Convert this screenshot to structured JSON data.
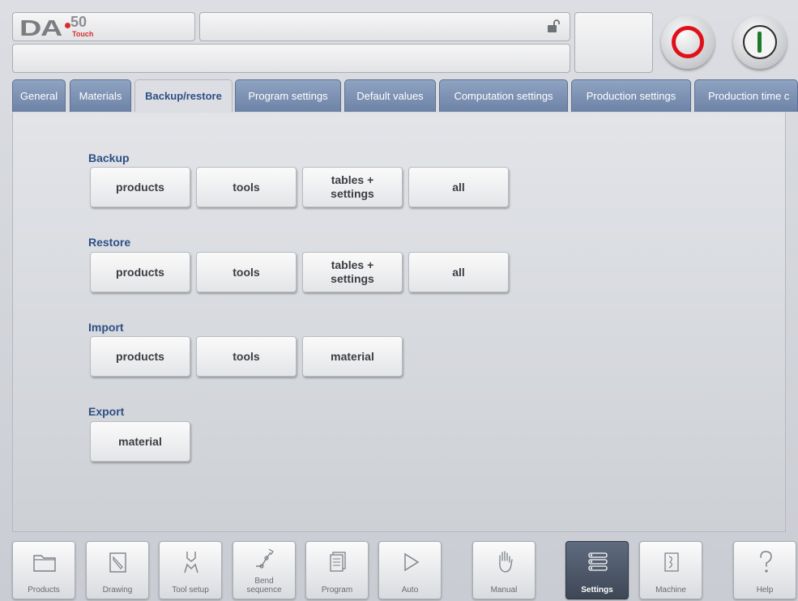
{
  "header": {
    "logo_main": "DA",
    "logo_model": "50",
    "logo_sub": "Touch"
  },
  "tabs": [
    {
      "label": "General",
      "active": false
    },
    {
      "label": "Materials",
      "active": false
    },
    {
      "label": "Backup/restore",
      "active": true
    },
    {
      "label": "Program settings",
      "active": false
    },
    {
      "label": "Default values",
      "active": false
    },
    {
      "label": "Computation settings",
      "active": false
    },
    {
      "label": "Production settings",
      "active": false
    },
    {
      "label": "Production time c",
      "active": false
    }
  ],
  "sections": {
    "backup": {
      "label": "Backup",
      "buttons": [
        "products",
        "tools",
        "tables +\nsettings",
        "all"
      ]
    },
    "restore": {
      "label": "Restore",
      "buttons": [
        "products",
        "tools",
        "tables +\nsettings",
        "all"
      ]
    },
    "import": {
      "label": "Import",
      "buttons": [
        "products",
        "tools",
        "material"
      ]
    },
    "export": {
      "label": "Export",
      "buttons": [
        "material"
      ]
    }
  },
  "nav": [
    {
      "label": "Products",
      "icon": "folder-icon",
      "active": false
    },
    {
      "label": "Drawing",
      "icon": "drawing-icon",
      "active": false
    },
    {
      "label": "Tool setup",
      "icon": "tool-setup-icon",
      "active": false
    },
    {
      "label": "Bend\nsequence",
      "icon": "bend-sequence-icon",
      "active": false
    },
    {
      "label": "Program",
      "icon": "program-icon",
      "active": false
    },
    {
      "label": "Auto",
      "icon": "play-icon",
      "active": false
    },
    {
      "label": "Manual",
      "icon": "hand-icon",
      "active": false
    },
    {
      "label": "Settings",
      "icon": "settings-list-icon",
      "active": true
    },
    {
      "label": "Machine",
      "icon": "machine-icon",
      "active": false
    },
    {
      "label": "Help",
      "icon": "help-icon",
      "active": false
    }
  ],
  "colors": {
    "tab_active_text": "#2d4f86",
    "tab_inactive": "#7a8fb2",
    "stop_red": "#e0101a",
    "start_green": "#1e7a2a",
    "nav_active": "#4a5466"
  }
}
